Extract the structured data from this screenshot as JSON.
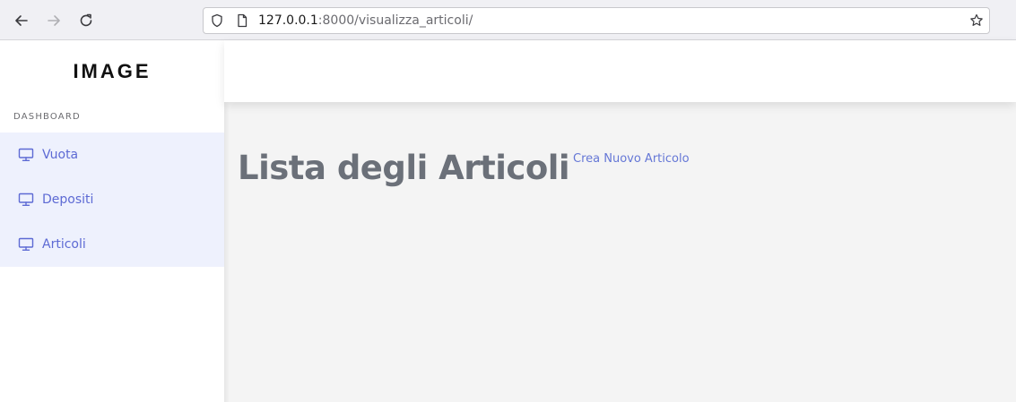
{
  "browser": {
    "url_host": "127.0.0.1",
    "url_rest": ":8000/visualizza_articoli/"
  },
  "sidebar": {
    "brand": "IMAGE",
    "section_label": "DASHBOARD",
    "items": [
      {
        "label": "Vuota",
        "icon": "monitor-icon"
      },
      {
        "label": "Depositi",
        "icon": "monitor-icon"
      },
      {
        "label": "Articoli",
        "icon": "monitor-icon"
      }
    ]
  },
  "main": {
    "title": "Lista degli Articoli",
    "create_link": "Crea Nuovo Articolo"
  },
  "colors": {
    "accent": "#5d6ad4",
    "menu_bg": "#eef1fd",
    "content_bg": "#f4f4f4",
    "title": "#6b7079"
  }
}
